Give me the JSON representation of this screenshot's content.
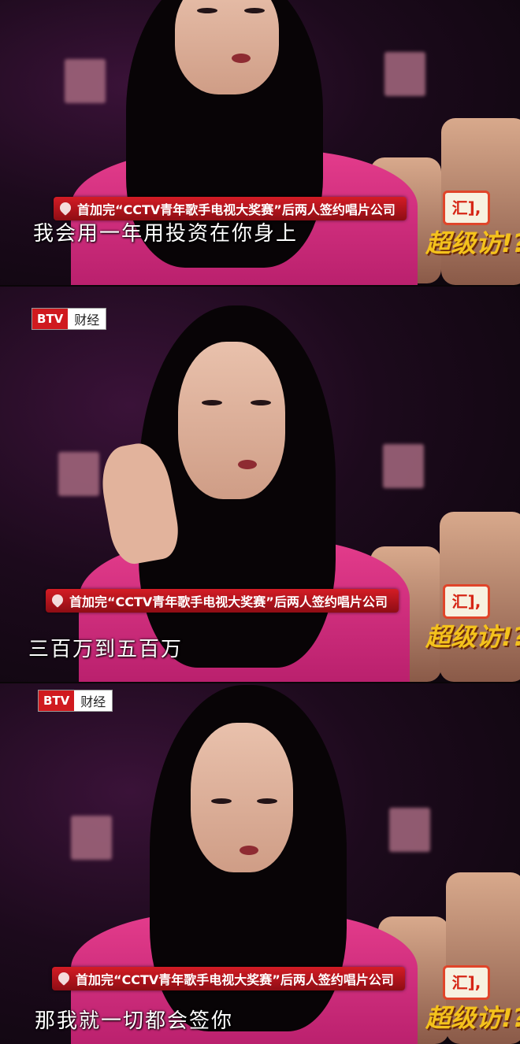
{
  "frames": [
    {
      "banner": "首加完“CCTV青年歌手电视大奖赛”后两人签约唱片公司",
      "subtitle": "我会用一年用投资在你身上",
      "show_logo_top": "汇],",
      "show_logo": "超级访!?"
    },
    {
      "channel_badge": "BTV",
      "channel_name": "财经",
      "banner": "首加完“CCTV青年歌手电视大奖赛”后两人签约唱片公司",
      "subtitle": "三百万到五百万",
      "show_logo_top": "汇],",
      "show_logo": "超级访!?"
    },
    {
      "channel_badge": "BTV",
      "channel_name": "财经",
      "banner": "首加完“CCTV青年歌手电视大奖赛”后两人签约唱片公司",
      "subtitle": "那我就一切都会签你",
      "show_logo_top": "汇],",
      "show_logo": "超级访!?"
    }
  ]
}
